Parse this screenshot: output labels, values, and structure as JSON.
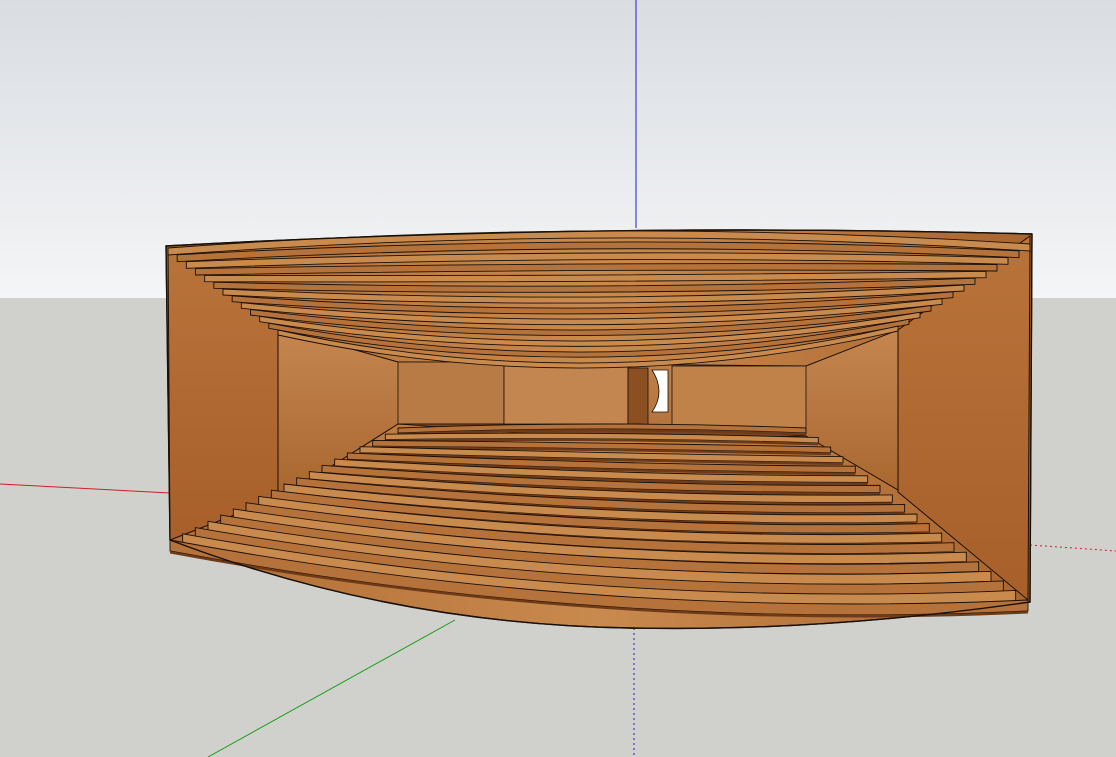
{
  "app": {
    "name": ""
  },
  "viewport": {
    "sky_color": "#e6eaee",
    "ground_color": "#d0d0cd",
    "axes": {
      "x_color": "#d02020",
      "y_color": "#18a018",
      "z_color": "#2020c8"
    }
  },
  "model": {
    "name": "curved-terraced-seating-model",
    "wood_light": "#c98a4e",
    "wood_mid": "#b5723a",
    "wood_dark": "#6e3a18",
    "edge_color": "#1a1008",
    "ceiling_tier_count": 13,
    "floor_tier_count": 19,
    "has_doorway": true
  }
}
